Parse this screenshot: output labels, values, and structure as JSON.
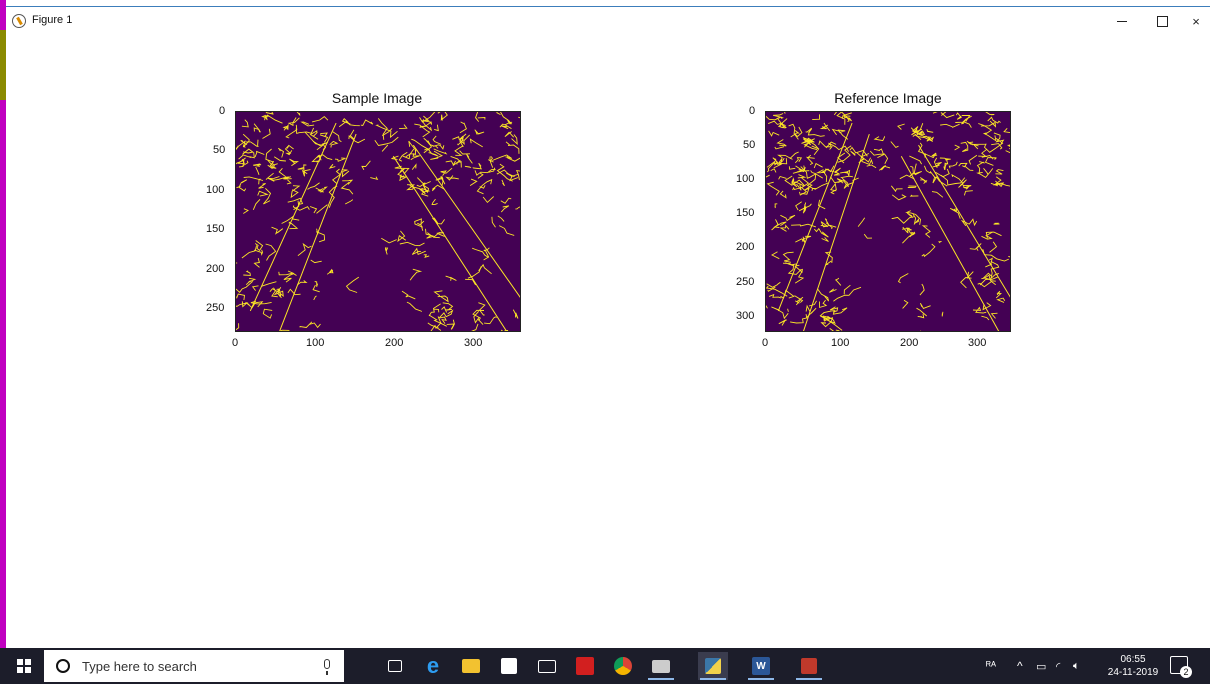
{
  "window": {
    "title": "Figure 1",
    "controls": {
      "minimize": "—",
      "maximize": "□",
      "close": "×"
    }
  },
  "figure": {
    "subplots": [
      {
        "title": "Sample Image",
        "x_ticks": [
          "0",
          "100",
          "200",
          "300"
        ],
        "y_ticks": [
          "0",
          "50",
          "100",
          "150",
          "200",
          "250"
        ],
        "image_colormap": "viridis (binary edge map)",
        "background_color": "#440154",
        "edge_color": "#fde725"
      },
      {
        "title": "Reference Image",
        "x_ticks": [
          "0",
          "100",
          "200",
          "300"
        ],
        "y_ticks": [
          "0",
          "50",
          "100",
          "150",
          "200",
          "250",
          "300"
        ],
        "image_colormap": "viridis (binary edge map)",
        "background_color": "#440154",
        "edge_color": "#fde725"
      }
    ]
  },
  "taskbar": {
    "search_placeholder": "Type here to search",
    "apps": [
      "task-view",
      "edge",
      "file-explorer",
      "store",
      "mail",
      "acrobat",
      "chrome",
      "terminal",
      "python",
      "word",
      "app"
    ],
    "tray": {
      "time": "06:55",
      "date": "24-11-2019",
      "notification_count": "2"
    }
  }
}
